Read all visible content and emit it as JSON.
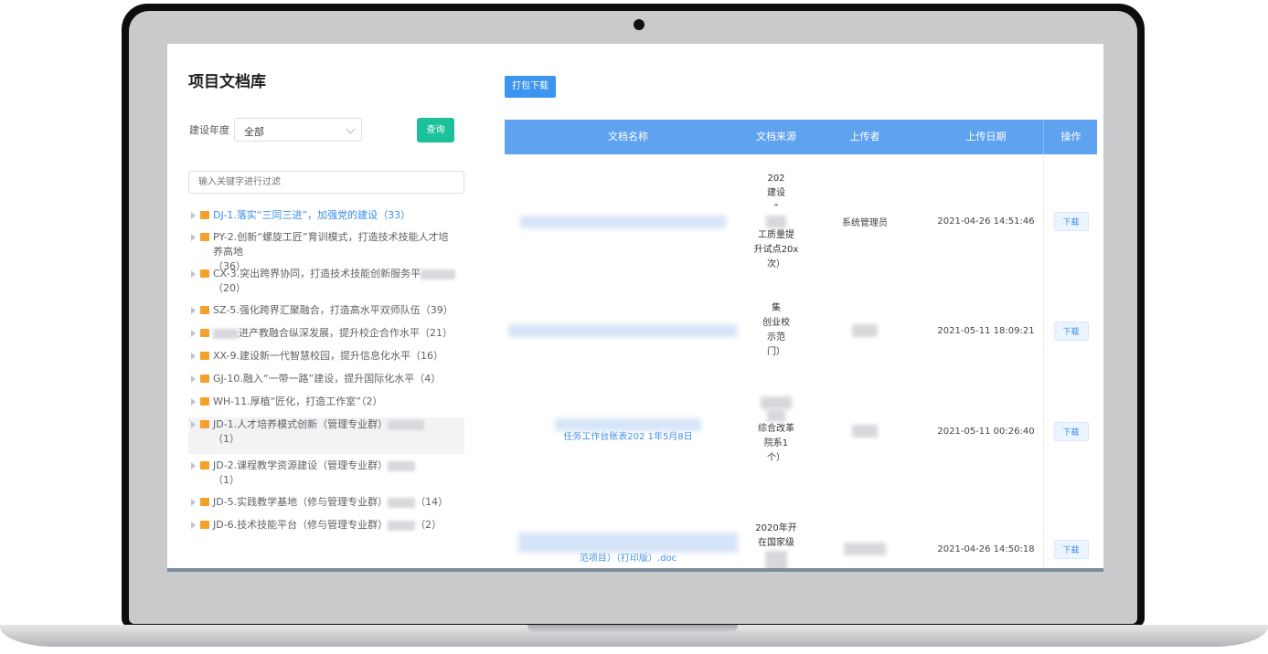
{
  "page": {
    "title": "项目文档库"
  },
  "filters": {
    "year_label": "建设年度",
    "year_value": "全部",
    "query_label": "查询",
    "keyword_placeholder": "输入关键字进行过滤"
  },
  "tree": [
    {
      "label": "DJ-1.落实“三同三进”，加强党的建设",
      "count": "（33）"
    },
    {
      "label": "PY-2.创新“螺旋工匠”育训模式，打造技术技能人才培养高地",
      "count": "（36）"
    },
    {
      "label": "CX-3.突出跨界协同，打造技术技能创新服务平",
      "count": "（20）"
    },
    {
      "label": "SZ-5.强化跨界汇聚融合，打造高水平双师队伍",
      "count": "（39）"
    },
    {
      "label": "进产教融合纵深发展，提升校企合作水平",
      "count": "（21）"
    },
    {
      "label": "XX-9.建设新一代智慧校园，提升信息化水平",
      "count": "（16）"
    },
    {
      "label": "GJ-10.融入“一带一路”建设，提升国际化水平",
      "count": "（4）"
    },
    {
      "label": "WH-11.厚植“匠化，打造工作室”",
      "count": "（2）"
    },
    {
      "label": "JD-1.人才培养模式创新（管理专业群）",
      "count": "（1）"
    },
    {
      "label": "JD-2.课程教学资源建设（管理专业群）",
      "count": "（1）"
    },
    {
      "label": "JD-5.实践教学基地（修与管理专业群）",
      "count": "（14）"
    },
    {
      "label": "JD-6.技术技能平台（修与管理专业群）",
      "count": "（2）"
    }
  ],
  "toolbar": {
    "pack_download_label": "打包下载"
  },
  "table": {
    "headers": {
      "name": "文档名称",
      "source": "文档来源",
      "uploader": "上传者",
      "date": "上传日期",
      "op": "操作"
    },
    "rows": [
      {
        "name": "",
        "source_lines": [
          "202",
          "建设",
          "“",
          "",
          "工质量提",
          "升试点20x",
          "次）"
        ],
        "uploader": "系统管理员",
        "date": "2021-04-26 14:51:46",
        "action": "下载"
      },
      {
        "name": "",
        "source_lines": [
          "集",
          "创业校",
          "示范",
          "门）"
        ],
        "uploader": "",
        "date": "2021-05-11 18:09:21",
        "action": "下载"
      },
      {
        "name": "任务工作台账表202 1年5月8日",
        "source_lines": [
          "",
          "",
          "综合改革",
          "院系1",
          "个）"
        ],
        "uploader": "",
        "date": "2021-05-11 00:26:40",
        "action": "下载"
      },
      {
        "name": "范项目）（打印版）.doc",
        "source_lines": [
          "2020年开",
          "在国家级",
          "",
          ""
        ],
        "uploader": "",
        "date": "2021-04-26 14:50:18",
        "action": "下载"
      }
    ]
  }
}
